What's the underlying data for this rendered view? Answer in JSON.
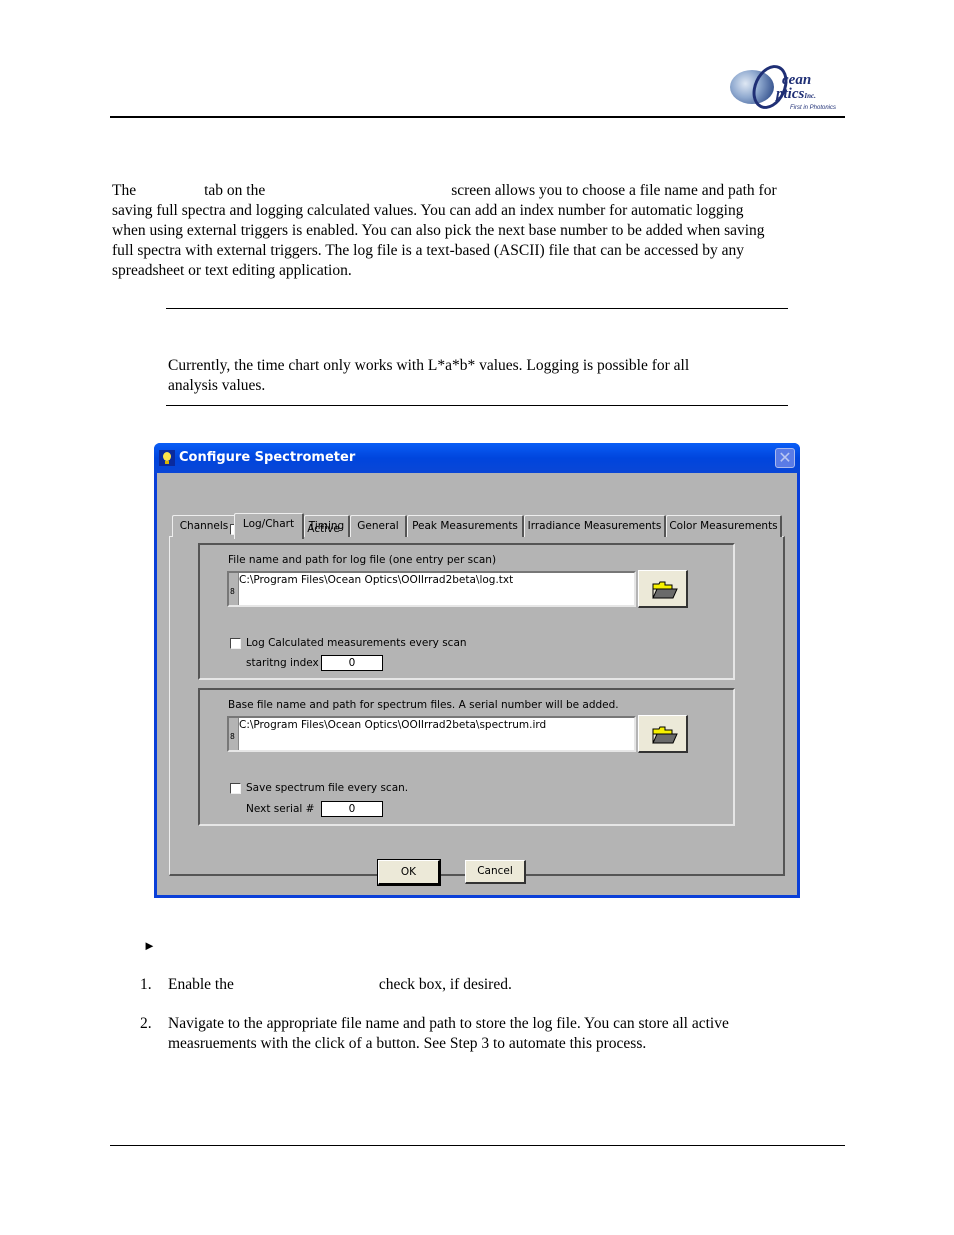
{
  "header": {
    "logo": {
      "brand_line1": "cean",
      "brand_line2": "ptics",
      "brand_suffix": "Inc.",
      "tagline": "First in Photonics"
    }
  },
  "intro": {
    "line1_part1": "The",
    "line1_part2": "tab on the",
    "line1_part3": "screen allows you to choose a file name and path for",
    "line2": "saving full spectra and logging calculated values. You can add an index number for automatic logging",
    "line3": "when using external triggers is enabled. You can also pick the next base number to be added when saving",
    "line4": "full spectra with external triggers. The log file is a text-based (ASCII) file that can be accessed by any",
    "line5": "spreadsheet or text editing application."
  },
  "note": {
    "line1": "Currently, the time chart only works with L*a*b* values.  Logging is possible for all",
    "line2": "analysis values."
  },
  "dialog": {
    "title": "Configure Spectrometer",
    "close_glyph": "✕",
    "tabs": [
      {
        "label": "Channels",
        "active": false
      },
      {
        "label": "Log/Chart",
        "active": true
      },
      {
        "label": "Timing",
        "active": false
      },
      {
        "label": "General",
        "active": false
      },
      {
        "label": "Peak Measurements",
        "active": false
      },
      {
        "label": "Irradiance Measurements",
        "active": false
      },
      {
        "label": "Color Measurements",
        "active": false
      }
    ],
    "time_chart_active": {
      "label": "Time Chart Active",
      "checked": false
    },
    "log_group": {
      "caption": "File name and path for log file (one entry per scan)",
      "path_value": "C:\\Program Files\\Ocean Optics\\OOIIrrad2beta\\log.txt",
      "log_every_scan": {
        "label": "Log Calculated measurements every scan",
        "checked": false
      },
      "index_label": "staritng index",
      "index_value": "0"
    },
    "spectrum_group": {
      "caption": "Base file name and path for spectrum files.  A serial number will be added.",
      "path_value": "C:\\Program Files\\Ocean Optics\\OOIIrrad2beta\\spectrum.ird",
      "save_every_scan": {
        "label": "Save spectrum file every scan.",
        "checked": false
      },
      "serial_label": "Next serial #",
      "serial_value": "0"
    },
    "gutter_glyph": "8",
    "ok_label": "OK",
    "cancel_label": "Cancel"
  },
  "procedure": {
    "arrow_glyph": "►",
    "steps": [
      {
        "num": "1.",
        "text_part1": "Enable the",
        "text_part2": "check box, if desired."
      },
      {
        "num": "2.",
        "line1": "Navigate to the appropriate file name and path to store the log file. You can store all active",
        "line2": "measruements with the click of a button. See Step 3 to automate this process."
      }
    ]
  }
}
